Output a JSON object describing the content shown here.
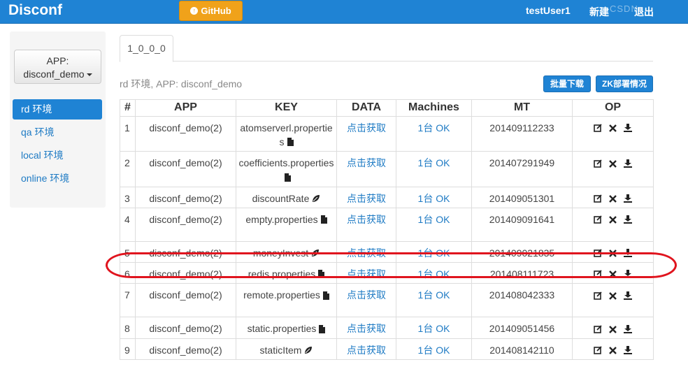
{
  "nav": {
    "brand": "Disconf",
    "github": "GitHub",
    "user": "testUser1",
    "new": "新建",
    "logout": "退出",
    "watermark": "CSDN"
  },
  "sidebar": {
    "app_label": "APP:",
    "app_value": "disconf_demo",
    "envs": [
      {
        "label": "rd 环境",
        "active": true
      },
      {
        "label": "qa 环境",
        "active": false
      },
      {
        "label": "local 环境",
        "active": false
      },
      {
        "label": "online 环境",
        "active": false
      }
    ]
  },
  "main": {
    "tab": "1_0_0_0",
    "breadcrumb": "rd 环境, APP: disconf_demo",
    "batch_download": "批量下载",
    "zk_status": "ZK部署情况",
    "columns": [
      "#",
      "APP",
      "KEY",
      "DATA",
      "Machines",
      "MT",
      "OP"
    ],
    "rows": [
      {
        "num": "1",
        "app": "disconf_demo(2)",
        "key": "atomserverl.properties",
        "icon": "file",
        "data": "点击获取",
        "machines": "1台 OK",
        "mt": "201409112233"
      },
      {
        "num": "2",
        "app": "disconf_demo(2)",
        "key": "coefficients.properties",
        "icon": "file",
        "data": "点击获取",
        "machines": "1台 OK",
        "mt": "201407291949"
      },
      {
        "num": "3",
        "app": "disconf_demo(2)",
        "key": "discountRate",
        "icon": "leaf",
        "data": "点击获取",
        "machines": "1台 OK",
        "mt": "201409051301"
      },
      {
        "num": "4",
        "app": "disconf_demo(2)",
        "key": "empty.properties",
        "icon": "file",
        "data": "点击获取",
        "machines": "1台 OK",
        "mt": "201409091641"
      },
      {
        "num": "5",
        "app": "disconf_demo(2)",
        "key": "moneyInvest",
        "icon": "leaf",
        "data": "点击获取",
        "machines": "1台 OK",
        "mt": "201409021835"
      },
      {
        "num": "6",
        "app": "disconf_demo(2)",
        "key": "redis.properties",
        "icon": "file",
        "data": "点击获取",
        "machines": "1台 OK",
        "mt": "201408111723"
      },
      {
        "num": "7",
        "app": "disconf_demo(2)",
        "key": "remote.properties",
        "icon": "file",
        "data": "点击获取",
        "machines": "1台 OK",
        "mt": "201408042333"
      },
      {
        "num": "8",
        "app": "disconf_demo(2)",
        "key": "static.properties",
        "icon": "file",
        "data": "点击获取",
        "machines": "1台 OK",
        "mt": "201409051456"
      },
      {
        "num": "9",
        "app": "disconf_demo(2)",
        "key": "staticItem",
        "icon": "leaf",
        "data": "点击获取",
        "machines": "1台 OK",
        "mt": "201408142110"
      }
    ],
    "op_icons": [
      "edit-icon",
      "delete-icon",
      "download-icon"
    ]
  },
  "colors": {
    "nav_blue": "#1f83d4",
    "github_orange": "#f0a21a",
    "link_blue": "#1f7bc4",
    "highlight_red": "#e0141e"
  }
}
